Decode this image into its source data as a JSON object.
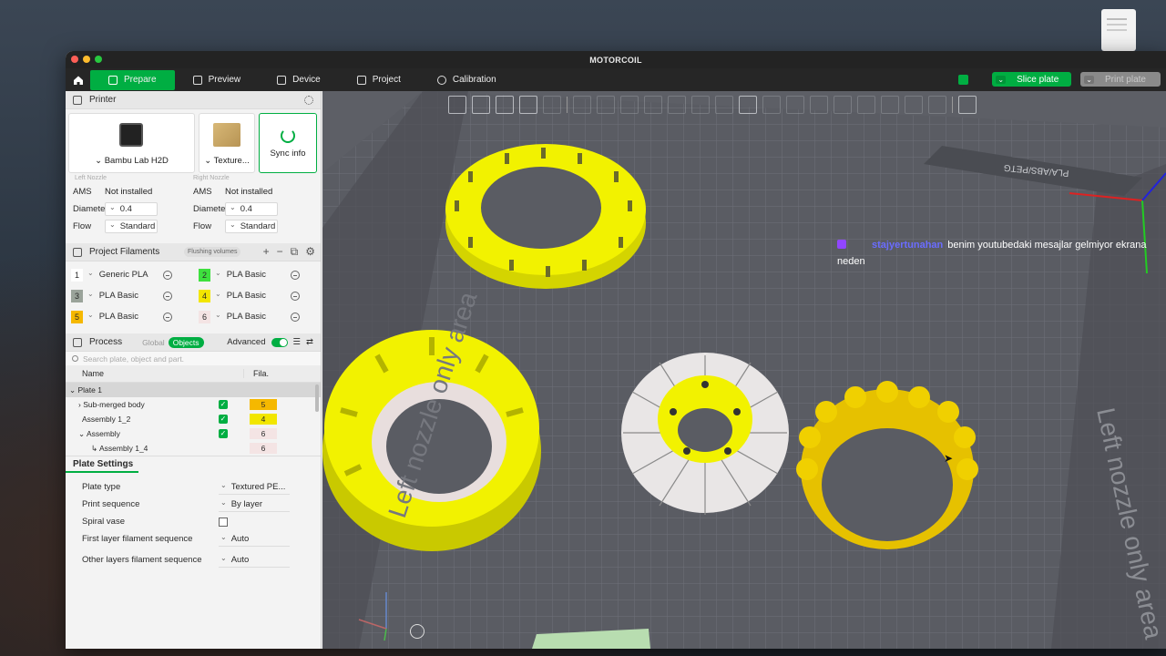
{
  "window": {
    "title": "MOTORCOIL"
  },
  "tabs": [
    {
      "label": "Prepare"
    },
    {
      "label": "Preview"
    },
    {
      "label": "Device"
    },
    {
      "label": "Project"
    },
    {
      "label": "Calibration"
    }
  ],
  "actions": {
    "slice": "Slice plate",
    "print": "Print plate"
  },
  "printer": {
    "title": "Printer",
    "model": "Bambu Lab H2D",
    "plate": "Texture...",
    "sync": "Sync info",
    "left_caption": "Left Nozzle",
    "right_caption": "Right Nozzle",
    "left": {
      "ams_label": "AMS",
      "ams_value": "Not installed",
      "diameter_label": "Diameter",
      "diameter": "0.4",
      "flow_label": "Flow",
      "flow": "Standard"
    },
    "right": {
      "ams_label": "AMS",
      "ams_value": "Not installed",
      "diameter_label": "Diameter",
      "diameter": "0.4",
      "flow_label": "Flow",
      "flow": "Standard"
    }
  },
  "filaments": {
    "title": "Project Filaments",
    "flush": "Flushing volumes",
    "items": [
      {
        "num": "1",
        "name": "Generic PLA",
        "color": "#ffffff"
      },
      {
        "num": "2",
        "name": "PLA Basic",
        "color": "#3ee03e"
      },
      {
        "num": "3",
        "name": "PLA Basic",
        "color": "#9aa39a"
      },
      {
        "num": "4",
        "name": "PLA Basic",
        "color": "#f2e600"
      },
      {
        "num": "5",
        "name": "PLA Basic",
        "color": "#f5b800"
      },
      {
        "num": "6",
        "name": "PLA Basic",
        "color": "#f4e4e4"
      }
    ]
  },
  "process": {
    "title": "Process",
    "global": "Global",
    "objects": "Objects",
    "advanced": "Advanced",
    "search_placeholder": "Search plate, object and part.",
    "col_name": "Name",
    "col_fila": "Fila.",
    "tree": [
      {
        "name": "Plate 1",
        "fila": "",
        "check": false
      },
      {
        "name": "Sub-merged body",
        "fila": "5",
        "check": true
      },
      {
        "name": "Assembly 1_2",
        "fila": "4",
        "check": true
      },
      {
        "name": "Assembly",
        "fila": "6",
        "check": true
      },
      {
        "name": "Assembly 1_4",
        "fila": "6",
        "check": false
      }
    ]
  },
  "plate_settings": {
    "title": "Plate Settings",
    "rows": [
      {
        "label": "Plate type",
        "value": "Textured PE..."
      },
      {
        "label": "Print sequence",
        "value": "By layer"
      },
      {
        "label": "Spiral vase",
        "value": ""
      },
      {
        "label": "First layer filament sequence",
        "value": "Auto"
      },
      {
        "label": "Other layers filament sequence",
        "value": "Auto"
      }
    ]
  },
  "viewport": {
    "left_zone": "Left nozzle only area",
    "right_zone": "Left nozzle only area",
    "plate_logo": "PLA/ABS/PETG",
    "chat_user": "stajyertunahan",
    "chat_message": "benim youtubedaki mesajlar gelmiyor ekrana neden"
  },
  "colors": {
    "accent": "#00ae42",
    "part_yellow": "#f2f200",
    "bed": "#5d5f66"
  }
}
